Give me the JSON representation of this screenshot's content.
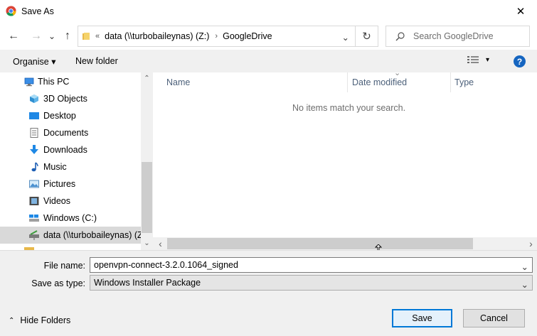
{
  "window": {
    "title": "Save As",
    "close_glyph": "✕",
    "app_icon": "chrome-icon"
  },
  "nav": {
    "back_glyph": "←",
    "forward_glyph": "→",
    "recent_glyph": "⌄",
    "up_glyph": "↑",
    "address": {
      "overflow_glyph": "«",
      "segments": [
        "data (\\\\turbobaileynas) (Z:)",
        "GoogleDrive"
      ],
      "separator_glyph": "›",
      "dropdown_glyph": "⌄"
    },
    "refresh_glyph": "↻",
    "search_placeholder": "Search GoogleDrive"
  },
  "toolbar": {
    "organise_label": "Organise ▾",
    "new_folder_label": "New folder",
    "view_dropdown_glyph": "▾",
    "help_label": "?"
  },
  "tree": {
    "items": [
      {
        "label": "This PC",
        "icon": "pc-icon"
      },
      {
        "label": "3D Objects",
        "icon": "3d-objects-icon"
      },
      {
        "label": "Desktop",
        "icon": "desktop-icon"
      },
      {
        "label": "Documents",
        "icon": "documents-icon"
      },
      {
        "label": "Downloads",
        "icon": "downloads-icon"
      },
      {
        "label": "Music",
        "icon": "music-icon"
      },
      {
        "label": "Pictures",
        "icon": "pictures-icon"
      },
      {
        "label": "Videos",
        "icon": "videos-icon"
      },
      {
        "label": "Windows (C:)",
        "icon": "drive-icon"
      },
      {
        "label": "data (\\\\turbobaileynas) (Z",
        "icon": "network-drive-icon",
        "selected": true
      }
    ],
    "scroll_up": "⌃",
    "scroll_down": "⌄"
  },
  "files": {
    "columns": [
      "Name",
      "Date modified",
      "Type"
    ],
    "sort_glyph": "⌄",
    "empty_message": "No items match your search.",
    "scroll_left": "‹",
    "scroll_right": "›"
  },
  "form": {
    "filename_label": "File name:",
    "filename_value": "openvpn-connect-3.2.0.1064_signed",
    "savetype_label": "Save as type:",
    "savetype_value": "Windows Installer Package",
    "dropdown_glyph": "⌄",
    "hide_folders_caret": "⌃",
    "hide_folders_label": "Hide Folders",
    "save_label": "Save",
    "cancel_label": "Cancel"
  },
  "colors": {
    "accent": "#0078d7",
    "help": "#1565c0",
    "column_header": "#4c607a"
  }
}
